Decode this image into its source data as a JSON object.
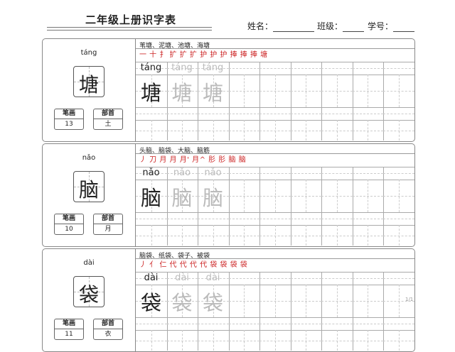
{
  "header": {
    "title": "二年级上册识字表",
    "name_label": "姓名：",
    "class_label": "班级：",
    "id_label": "学号："
  },
  "cards": [
    {
      "pinyin": "táng",
      "char": "塘",
      "stroke_label": "笔画",
      "stroke_count": "13",
      "radical_label": "部首",
      "radical": "土",
      "words": "苇塘、泥塘、池塘、海塘",
      "stroke_order": "一 十 扌 扩 扩 扩 护 护 护 捧 捧 捧 塘"
    },
    {
      "pinyin": "nǎo",
      "char": "脑",
      "stroke_label": "笔画",
      "stroke_count": "10",
      "radical_label": "部首",
      "radical": "月",
      "words": "头脑、脑袋、大脑、脑筋",
      "stroke_order": "丿 刀 月 月 月' 月^ 肜 肜 脑 脑"
    },
    {
      "pinyin": "dài",
      "char": "袋",
      "stroke_label": "笔画",
      "stroke_count": "11",
      "radical_label": "部首",
      "radical": "衣",
      "words": "脑袋、纸袋、袋子、被袋",
      "stroke_order": "丿 亻 仁 代 代 代 代 袋 袋 袋 袋"
    }
  ],
  "page_number": "1/1"
}
